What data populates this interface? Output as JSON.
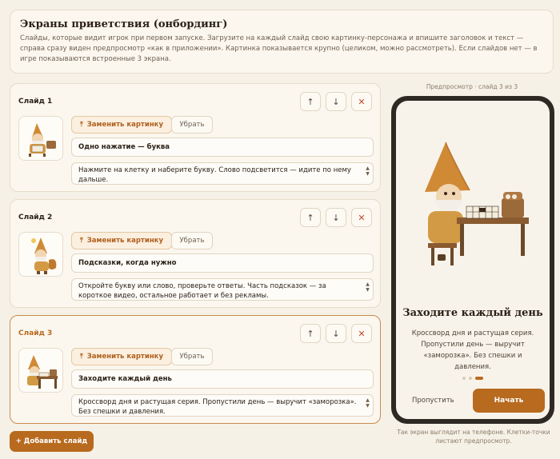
{
  "header": {
    "title": "Экраны приветствия (онбординг)",
    "description": "Слайды, которые видит игрок при первом запуске. Загрузите на каждый слайд свою картинку-персонажа и впишите заголовок и текст — справа сразу виден предпросмотр «как в приложении». Картинка показывается крупно (целиком, можно рассмотреть). Если слайдов нет — в игре показываются встроенные 3 экрана."
  },
  "controls": {
    "up": "↑",
    "down": "↓",
    "close": "✕"
  },
  "slides": [
    {
      "label": "Слайд 1",
      "replace_label": "Заменить картинку",
      "remove_label": "Убрать",
      "title": "Одно нажатие — буква",
      "text": "Нажмите на клетку и наберите букву. Слово подсветится — идите по нему дальше."
    },
    {
      "label": "Слайд 2",
      "replace_label": "Заменить картинку",
      "remove_label": "Убрать",
      "title": "Подсказки, когда нужно",
      "text": "Откройте букву или слово, проверьте ответы. Часть подсказок — за короткое видео, остальное работает и без рекламы."
    },
    {
      "label": "Слайд 3",
      "replace_label": "Заменить картинку",
      "remove_label": "Убрать",
      "title": "Заходите каждый день",
      "text": "Кроссворд дня и растущая серия. Пропустили день — выручит «заморозка». Без спешки и давления."
    }
  ],
  "add_button": "+ Добавить слайд",
  "preview": {
    "caption": "Предпросмотр · слайд 3 из 3",
    "title": "Заходите каждый день",
    "text": "Кроссворд дня и растущая серия. Пропустили день — выручит «заморозка». Без спешки и давления.",
    "dots_total": 3,
    "dots_active": 3,
    "skip": "Пропустить",
    "start": "Начать",
    "footnote": "Так экран выглядит на телефоне. Клетки-точки листают предпросмотр."
  }
}
